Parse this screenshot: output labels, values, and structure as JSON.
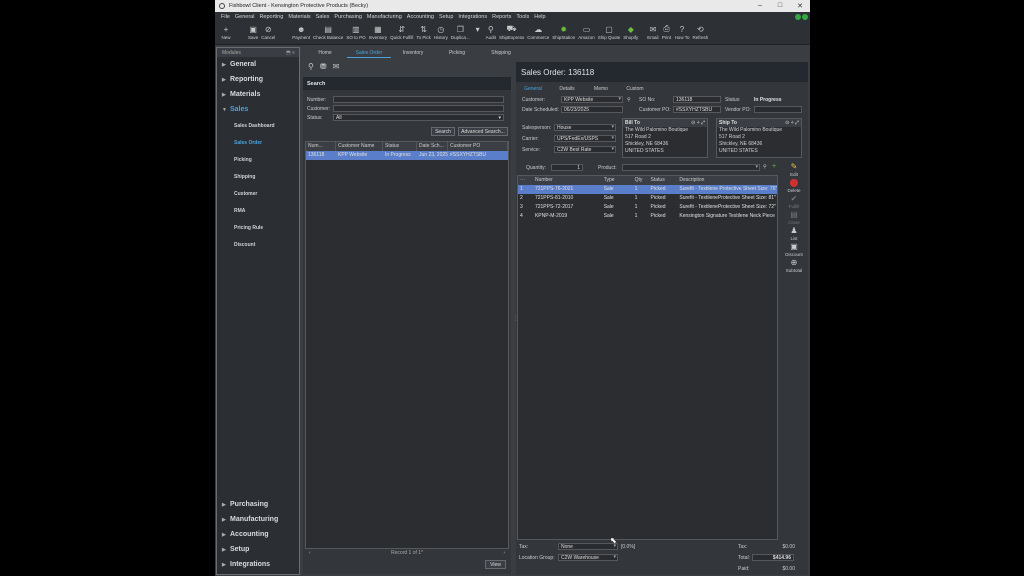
{
  "window": {
    "title": "Fishbowl Client - Kensington Protective Products (Becky)"
  },
  "menu": [
    "File",
    "General",
    "Reporting",
    "Materials",
    "Sales",
    "Purchasing",
    "Manufacturing",
    "Accounting",
    "Setup",
    "Integrations",
    "Reports",
    "Tools",
    "Help"
  ],
  "toolbar": [
    {
      "label": "New",
      "icon": "plus-icon"
    },
    {
      "label": "Save",
      "icon": "save-icon"
    },
    {
      "label": "Cancel",
      "icon": "cancel-icon"
    },
    {
      "label": "Payment",
      "icon": "payment-icon"
    },
    {
      "label": "Check Balance",
      "icon": "balance-icon"
    },
    {
      "label": "SO to PO",
      "icon": "convert-icon"
    },
    {
      "label": "Inventory",
      "icon": "inventory-icon"
    },
    {
      "label": "Quick Fulfill",
      "icon": "fulfill-icon"
    },
    {
      "label": "To Pick",
      "icon": "pick-icon"
    },
    {
      "label": "History",
      "icon": "history-icon"
    },
    {
      "label": "Duplica...",
      "icon": "duplicate-icon"
    },
    {
      "label": "Audit",
      "icon": "audit-icon"
    },
    {
      "label": "ShipExpress",
      "icon": "ship-icon"
    },
    {
      "label": "Commerce",
      "icon": "commerce-icon"
    },
    {
      "label": "ShipStation",
      "icon": "shipstation-icon"
    },
    {
      "label": "Amazon",
      "icon": "amazon-icon"
    },
    {
      "label": "Ship Quote",
      "icon": "quote-icon"
    },
    {
      "label": "Shopify",
      "icon": "shopify-icon"
    },
    {
      "label": "Email",
      "icon": "email-icon"
    },
    {
      "label": "Print",
      "icon": "print-icon"
    },
    {
      "label": "How To",
      "icon": "help-icon"
    },
    {
      "label": "Refresh",
      "icon": "refresh-icon"
    }
  ],
  "modules": {
    "header": "Modules",
    "top": [
      "General",
      "Reporting",
      "Materials",
      "Sales"
    ],
    "active": "Sales",
    "sales_items": [
      "Sales Dashboard",
      "Sales Order",
      "Picking",
      "Shipping",
      "Customer",
      "RMA",
      "Pricing Rule",
      "Discount"
    ],
    "active_item": "Sales Order",
    "bottom": [
      "Purchasing",
      "Manufacturing",
      "Accounting",
      "Setup",
      "Integrations"
    ]
  },
  "top_tabs": [
    "Home",
    "Sales Order",
    "Inventory",
    "Picking",
    "Shipping"
  ],
  "active_top_tab": "Sales Order",
  "search": {
    "title": "Search",
    "number_label": "Number:",
    "customer_label": "Customer:",
    "status_label": "Status:",
    "status_value": "All",
    "search_button": "Search",
    "advanced_button": "Advanced Search...",
    "columns": [
      "Num...",
      "Customer Name",
      "Status",
      "Date Sch...",
      "Customer PO"
    ],
    "rows": [
      [
        "136118",
        "KPP Website",
        "In Progress",
        "Jun 23, 2025",
        "#SSXYHZTSBU"
      ]
    ],
    "record_text": "Record 1 of 1*",
    "view_button": "View"
  },
  "sales_order": {
    "title": "Sales Order: 136118",
    "tabs": [
      "General",
      "Details",
      "Memo",
      "Custom"
    ],
    "active_tab": "General",
    "customer_label": "Customer:",
    "customer_value": "KPP Website",
    "date_label": "Date Scheduled:",
    "date_value": "06/23/2025",
    "so_no_label": "SO No:",
    "so_no_value": "136118",
    "customer_po_label": "Customer PO:",
    "customer_po_value": "#SSXYHZTSBU",
    "status_label": "Status:",
    "status_value": "In Progress",
    "vendor_po_label": "Vendor PO:",
    "vendor_po_value": "",
    "salesperson_label": "Salesperson:",
    "salesperson_value": "House",
    "carrier_label": "Carrier:",
    "carrier_value": "UPS/FedEx/USPS",
    "service_label": "Service:",
    "service_value": "C2W Best Rate",
    "bill_to": {
      "title": "Bill To",
      "lines": [
        "The Wild Palomino Boutique",
        "517 Road 2",
        "Shickley, NE 68436",
        "UNITED STATES"
      ]
    },
    "ship_to": {
      "title": "Ship To",
      "lines": [
        "The Wild Palomino Boutique",
        "517 Road 2",
        "Shickley, NE 68436",
        "UNITED STATES"
      ]
    },
    "quantity_label": "Quantity:",
    "quantity_value": "1",
    "product_label": "Product:",
    "items_columns": [
      "",
      "Number",
      "Type",
      "Qty",
      "Status",
      "Description"
    ],
    "items": [
      [
        "1",
        "721PPS-76-2021",
        "Sale",
        "1",
        "Picked",
        "Surefit - Textilene Protective Sheet Size: 76\""
      ],
      [
        "2",
        "721PPS-81-2010",
        "Sale",
        "1",
        "Picked",
        "Surefit - TextileneProtective Sheet Size: 81\""
      ],
      [
        "3",
        "721PPS-72-2017",
        "Sale",
        "1",
        "Picked",
        "Surefit - TextileneProtective Sheet Size: 72\""
      ],
      [
        "4",
        "KPNP-M-2019",
        "Sale",
        "1",
        "Picked",
        "Kensington Signature Textilene Neck Piece"
      ]
    ],
    "side_actions": [
      "Edit",
      "Delete",
      "Fulfill",
      "Close",
      "List",
      "Discount",
      "Subtotal"
    ],
    "tax_label": "Tax:",
    "tax_value": "None",
    "tax_rate": "[0.0%]",
    "location_group_label": "Location Group:",
    "location_group_value": "C2W Warehouse",
    "totals": [
      {
        "label": "Tax:",
        "value": "$0.00"
      },
      {
        "label": "Total:",
        "value": "$414.96"
      },
      {
        "label": "Paid:",
        "value": "$0.00"
      }
    ]
  }
}
